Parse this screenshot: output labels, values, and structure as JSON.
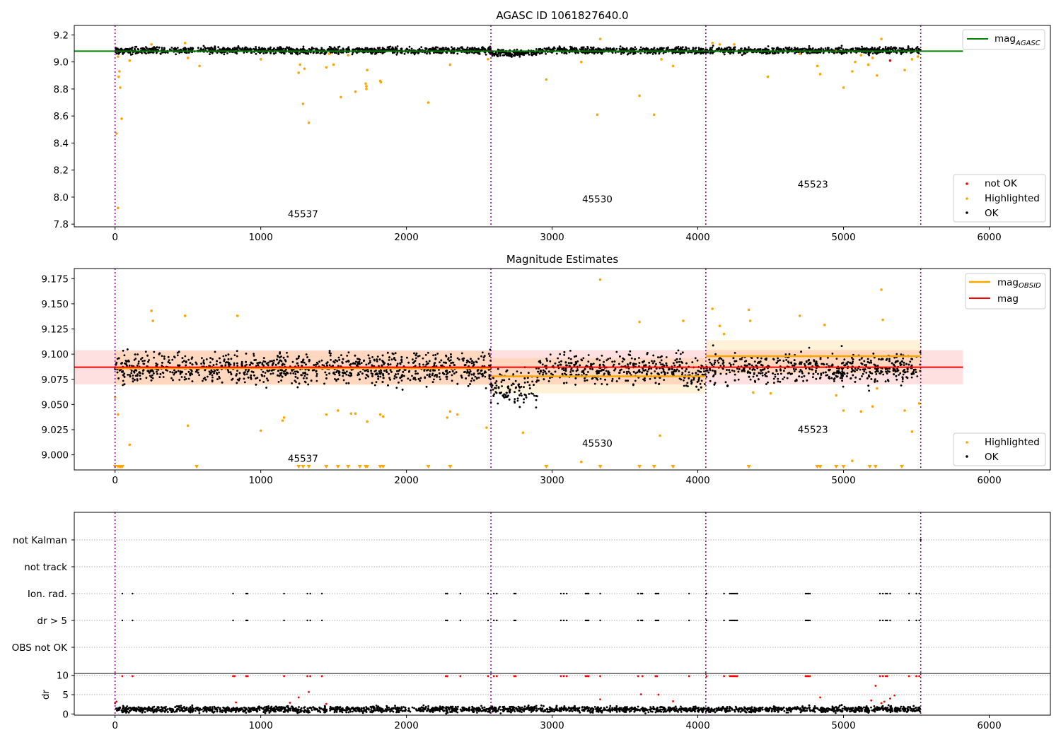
{
  "figure": {
    "x_ticks": [
      0,
      1000,
      2000,
      3000,
      4000,
      5000,
      6000
    ],
    "xlim": [
      -280,
      6420
    ],
    "obsid_boundaries": [
      0,
      2580,
      4055,
      5530
    ],
    "colors": {
      "ok": "#000000",
      "highlighted": "#ffa500",
      "not_ok": "#ff0000",
      "agasc_line": "#008000",
      "obsid_line": "#ffa500",
      "mag_line": "#ff0000",
      "boundary": "#800080",
      "grid": "#b0b0b0"
    }
  },
  "chart_data": [
    {
      "type": "scatter",
      "title": "AGASC ID 1061827640.0",
      "ylim": [
        7.78,
        9.27
      ],
      "y_ticks": [
        "7.8",
        "8.0",
        "8.2",
        "8.4",
        "8.6",
        "8.8",
        "9.0",
        "9.2"
      ],
      "obsid_labels": [
        {
          "text": "45537",
          "x": 1290,
          "y": 7.85
        },
        {
          "text": "45530",
          "x": 3310,
          "y": 7.96
        },
        {
          "text": "45523",
          "x": 4790,
          "y": 8.07
        }
      ],
      "agasc_mag": {
        "value": 9.08,
        "x_range": [
          -280,
          5820
        ]
      },
      "ok_band": {
        "center": 9.085,
        "spread": 0.025,
        "dips": [
          [
            2580,
            2900,
            -0.03
          ]
        ]
      },
      "highlighted_points": [
        [
          10,
          8.47
        ],
        [
          20,
          7.92
        ],
        [
          25,
          8.89
        ],
        [
          30,
          8.93
        ],
        [
          35,
          8.81
        ],
        [
          45,
          8.58
        ],
        [
          20,
          9.04
        ],
        [
          100,
          9.01
        ],
        [
          250,
          9.13
        ],
        [
          480,
          9.14
        ],
        [
          500,
          9.03
        ],
        [
          580,
          8.97
        ],
        [
          1000,
          9.02
        ],
        [
          1260,
          8.92
        ],
        [
          1270,
          8.98
        ],
        [
          1290,
          8.69
        ],
        [
          1300,
          8.95
        ],
        [
          1330,
          8.55
        ],
        [
          1450,
          8.96
        ],
        [
          1470,
          9.06
        ],
        [
          1500,
          8.98
        ],
        [
          1550,
          8.74
        ],
        [
          1600,
          9.05
        ],
        [
          1650,
          8.78
        ],
        [
          1720,
          8.84
        ],
        [
          1725,
          8.8
        ],
        [
          1725,
          8.82
        ],
        [
          1730,
          8.94
        ],
        [
          1820,
          8.86
        ],
        [
          1825,
          8.85
        ],
        [
          2150,
          8.7
        ],
        [
          2300,
          8.98
        ],
        [
          2560,
          9.02
        ],
        [
          2960,
          8.87
        ],
        [
          3200,
          9.0
        ],
        [
          3310,
          8.61
        ],
        [
          3330,
          9.17
        ],
        [
          3600,
          8.75
        ],
        [
          3700,
          8.61
        ],
        [
          3750,
          9.02
        ],
        [
          3830,
          8.97
        ],
        [
          4100,
          9.14
        ],
        [
          4150,
          9.13
        ],
        [
          4250,
          9.13
        ],
        [
          4480,
          8.89
        ],
        [
          4700,
          9.06
        ],
        [
          4820,
          8.97
        ],
        [
          4840,
          8.91
        ],
        [
          4950,
          9.08
        ],
        [
          5000,
          8.81
        ],
        [
          5060,
          8.93
        ],
        [
          5080,
          9.0
        ],
        [
          5120,
          9.05
        ],
        [
          5170,
          8.98
        ],
        [
          5200,
          9.03
        ],
        [
          5230,
          8.9
        ],
        [
          5260,
          9.17
        ],
        [
          5420,
          8.94
        ],
        [
          5470,
          9.02
        ],
        [
          5510,
          9.04
        ]
      ],
      "not_ok_points": [
        [
          5320,
          9.01
        ]
      ],
      "legend": [
        {
          "label": "mag",
          "sub": "AGASC",
          "kind": "line",
          "color": "#008000"
        }
      ],
      "legend2": [
        {
          "label": "not OK",
          "kind": "dot",
          "color": "#ff0000"
        },
        {
          "label": "Highlighted",
          "kind": "dot",
          "color": "#ffa500"
        },
        {
          "label": "OK",
          "kind": "dot",
          "color": "#000000"
        }
      ]
    },
    {
      "type": "scatter",
      "title": "Magnitude Estimates",
      "ylim": [
        8.985,
        9.185
      ],
      "y_ticks": [
        "9.000",
        "9.025",
        "9.050",
        "9.075",
        "9.100",
        "9.125",
        "9.150",
        "9.175"
      ],
      "obsid_labels": [
        {
          "text": "45537",
          "x": 1290,
          "y": 8.993
        },
        {
          "text": "45530",
          "x": 3310,
          "y": 9.008
        },
        {
          "text": "45523",
          "x": 4790,
          "y": 9.022
        }
      ],
      "mag": {
        "value": 9.087,
        "x_range": [
          -280,
          5820
        ],
        "band": [
          9.07,
          9.104
        ]
      },
      "obsid_mags": [
        {
          "x_range": [
            0,
            2580
          ],
          "value": 9.086,
          "band": [
            9.069,
            9.103
          ]
        },
        {
          "x_range": [
            2580,
            4055
          ],
          "value": 9.078,
          "band": [
            9.061,
            9.096
          ]
        },
        {
          "x_range": [
            4055,
            5530
          ],
          "value": 9.098,
          "band": [
            9.081,
            9.114
          ]
        }
      ],
      "ok_band": {
        "center": 9.086,
        "spread": 0.016,
        "dips": [
          [
            2580,
            2900,
            -0.03
          ],
          [
            3900,
            4055,
            -0.01
          ]
        ]
      },
      "highlighted_points": [
        [
          0,
          9.057
        ],
        [
          20,
          9.04
        ],
        [
          100,
          9.01
        ],
        [
          250,
          9.143
        ],
        [
          260,
          9.133
        ],
        [
          480,
          9.138
        ],
        [
          500,
          9.029
        ],
        [
          840,
          9.138
        ],
        [
          1000,
          9.024
        ],
        [
          1150,
          9.034
        ],
        [
          1160,
          9.037
        ],
        [
          1450,
          9.04
        ],
        [
          1530,
          9.044
        ],
        [
          1620,
          9.041
        ],
        [
          1650,
          9.041
        ],
        [
          1730,
          9.033
        ],
        [
          1820,
          9.04
        ],
        [
          1840,
          9.038
        ],
        [
          2280,
          9.037
        ],
        [
          2300,
          9.043
        ],
        [
          2350,
          9.04
        ],
        [
          2550,
          9.027
        ],
        [
          2800,
          9.022
        ],
        [
          3200,
          8.993
        ],
        [
          3330,
          9.174
        ],
        [
          3600,
          9.132
        ],
        [
          3740,
          9.019
        ],
        [
          3900,
          9.133
        ],
        [
          4100,
          9.145
        ],
        [
          4150,
          9.128
        ],
        [
          4180,
          9.12
        ],
        [
          4350,
          9.144
        ],
        [
          4360,
          9.133
        ],
        [
          4380,
          9.062
        ],
        [
          4500,
          9.061
        ],
        [
          4700,
          9.138
        ],
        [
          4870,
          9.129
        ],
        [
          4950,
          9.059
        ],
        [
          5000,
          9.044
        ],
        [
          5060,
          8.994
        ],
        [
          5120,
          9.043
        ],
        [
          5200,
          9.048
        ],
        [
          5230,
          9.066
        ],
        [
          5260,
          9.164
        ],
        [
          5270,
          9.134
        ],
        [
          5420,
          9.044
        ],
        [
          5470,
          9.023
        ],
        [
          5520,
          9.051
        ]
      ],
      "below_markers_x": [
        0,
        20,
        30,
        40,
        50,
        560,
        1260,
        1290,
        1330,
        1450,
        1530,
        1600,
        1680,
        1720,
        1730,
        1820,
        1840,
        2150,
        2300,
        2960,
        3330,
        3600,
        3700,
        3830,
        4350,
        4820,
        4840,
        4950,
        5000,
        5180,
        5220,
        5400
      ],
      "legend": [
        {
          "label": "mag",
          "sub": "OBSID",
          "kind": "line",
          "color": "#ffa500"
        },
        {
          "label": "mag",
          "sub": "",
          "kind": "line",
          "color": "#ff0000"
        }
      ],
      "legend2": [
        {
          "label": "Highlighted",
          "kind": "dot",
          "color": "#ffa500"
        },
        {
          "label": "OK",
          "kind": "dot",
          "color": "#000000"
        }
      ]
    },
    {
      "type": "scatter",
      "categories": [
        "not Kalman",
        "not track",
        "Ion. rad.",
        "dr > 5",
        "OBS not OK"
      ],
      "flag_x": {
        "not Kalman": [
          5530
        ],
        "not track": [],
        "Ion. rad.": [
          50,
          120,
          810,
          900,
          910,
          1160,
          1320,
          1340,
          1420,
          2270,
          2280,
          2370,
          2560,
          2600,
          2620,
          2740,
          2750,
          3060,
          3080,
          3100,
          3230,
          3240,
          3250,
          3330,
          3590,
          3610,
          3620,
          3710,
          3720,
          3730,
          3940,
          4060,
          4180,
          4220,
          4230,
          4240,
          4250,
          4260,
          4270,
          4740,
          4750,
          4760,
          4770,
          5250,
          5270,
          5290,
          5300,
          5320,
          5450,
          5500,
          5520
        ],
        "dr > 5": [
          50,
          120,
          810,
          900,
          910,
          1160,
          1320,
          1340,
          1420,
          2270,
          2280,
          2370,
          2560,
          2600,
          2620,
          2740,
          2750,
          3060,
          3080,
          3100,
          3230,
          3240,
          3250,
          3330,
          3590,
          3610,
          3620,
          3710,
          3720,
          3730,
          3940,
          4060,
          4180,
          4220,
          4230,
          4240,
          4250,
          4260,
          4270,
          4740,
          4750,
          4760,
          4770,
          5250,
          5270,
          5290,
          5300,
          5320,
          5450,
          5500,
          5520
        ],
        "OBS not OK": []
      }
    },
    {
      "type": "scatter",
      "ylabel": "dr",
      "ylim": [
        -0.3,
        10.5
      ],
      "y_ticks": [
        "0",
        "5",
        "10"
      ],
      "ok_band": {
        "center": 1.2,
        "spread": 1.0
      },
      "red_points": [
        [
          0,
          2.8
        ],
        [
          10,
          3.2
        ],
        [
          50,
          9.8
        ],
        [
          120,
          9.8
        ],
        [
          810,
          9.8
        ],
        [
          820,
          9.8
        ],
        [
          830,
          3.0
        ],
        [
          900,
          9.8
        ],
        [
          910,
          9.8
        ],
        [
          1160,
          9.8
        ],
        [
          1200,
          2.9
        ],
        [
          1260,
          4.3
        ],
        [
          1320,
          9.8
        ],
        [
          1330,
          5.7
        ],
        [
          1340,
          9.8
        ],
        [
          1420,
          9.8
        ],
        [
          1450,
          2.6
        ],
        [
          2270,
          9.8
        ],
        [
          2280,
          9.8
        ],
        [
          2370,
          9.8
        ],
        [
          2560,
          9.8
        ],
        [
          2600,
          9.8
        ],
        [
          2620,
          9.8
        ],
        [
          2740,
          9.8
        ],
        [
          2750,
          9.8
        ],
        [
          3060,
          9.8
        ],
        [
          3080,
          9.8
        ],
        [
          3100,
          9.8
        ],
        [
          3230,
          9.8
        ],
        [
          3240,
          9.8
        ],
        [
          3250,
          9.8
        ],
        [
          3330,
          9.8
        ],
        [
          3330,
          3.8
        ],
        [
          3590,
          9.8
        ],
        [
          3610,
          5.1
        ],
        [
          3620,
          9.8
        ],
        [
          3710,
          9.8
        ],
        [
          3720,
          9.8
        ],
        [
          3730,
          5.0
        ],
        [
          3830,
          3.3
        ],
        [
          3940,
          9.8
        ],
        [
          4060,
          9.8
        ],
        [
          4180,
          9.8
        ],
        [
          4220,
          9.8
        ],
        [
          4230,
          9.8
        ],
        [
          4240,
          9.8
        ],
        [
          4250,
          9.8
        ],
        [
          4260,
          9.8
        ],
        [
          4270,
          9.8
        ],
        [
          4740,
          9.8
        ],
        [
          4750,
          9.8
        ],
        [
          4760,
          9.8
        ],
        [
          4770,
          9.8
        ],
        [
          4840,
          4.3
        ],
        [
          5190,
          3.5
        ],
        [
          5220,
          7.3
        ],
        [
          5250,
          9.8
        ],
        [
          5260,
          2.8
        ],
        [
          5270,
          9.8
        ],
        [
          5280,
          3.2
        ],
        [
          5290,
          9.8
        ],
        [
          5300,
          9.8
        ],
        [
          5320,
          4.0
        ],
        [
          5350,
          4.8
        ],
        [
          5450,
          9.8
        ],
        [
          5500,
          9.8
        ],
        [
          5520,
          9.8
        ]
      ]
    }
  ]
}
